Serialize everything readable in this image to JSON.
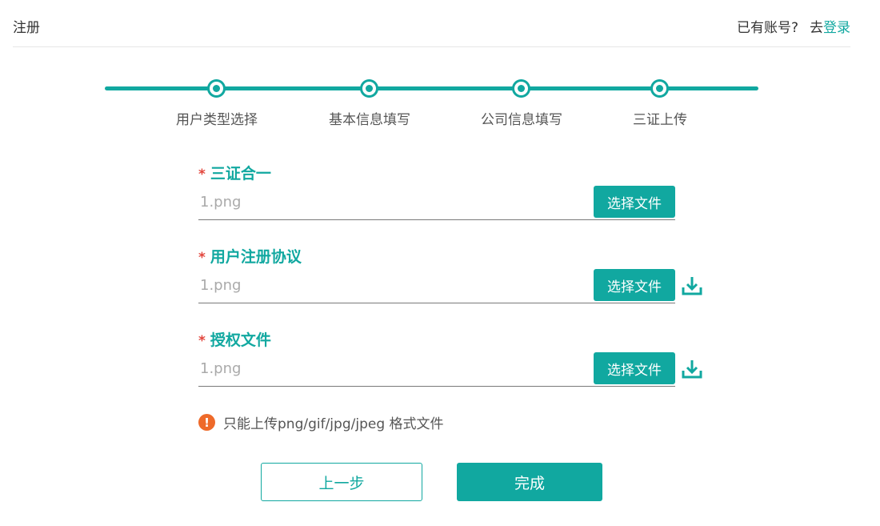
{
  "header": {
    "title": "注册",
    "have_account": "已有账号?",
    "go": "去",
    "login": "登录"
  },
  "steps": [
    {
      "label": "用户类型选择"
    },
    {
      "label": "基本信息填写"
    },
    {
      "label": "公司信息填写"
    },
    {
      "label": "三证上传"
    }
  ],
  "fields": [
    {
      "required_mark": "*",
      "label": "三证合一",
      "value": "1.png",
      "button": "选择文件"
    },
    {
      "required_mark": "*",
      "label": "用户注册协议",
      "value": "1.png",
      "button": "选择文件",
      "download_icon": "download-icon"
    },
    {
      "required_mark": "*",
      "label": "授权文件",
      "value": "1.png",
      "button": "选择文件",
      "download_icon": "download-icon"
    }
  ],
  "hint": {
    "icon": "!",
    "text": "只能上传png/gif/jpg/jpeg 格式文件"
  },
  "buttons": {
    "prev": "上一步",
    "finish": "完成"
  },
  "colors": {
    "accent": "#11a8a0",
    "required": "#e2453c",
    "warning": "#ee6a2a"
  }
}
